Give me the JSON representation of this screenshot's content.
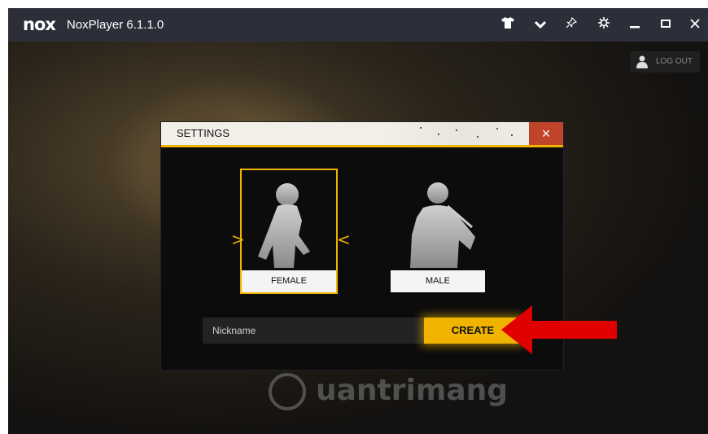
{
  "titlebar": {
    "logo": "nox",
    "title": "NoxPlayer 6.1.1.0",
    "icons": [
      "shirt-icon",
      "chevron-down-icon",
      "pin-icon",
      "gear-icon",
      "minimize-icon",
      "maximize-icon",
      "close-icon"
    ]
  },
  "game": {
    "logout_label": "LOG OUT"
  },
  "dialog": {
    "title": "SETTINGS",
    "close_symbol": "×",
    "characters": [
      {
        "label": "FEMALE",
        "selected": true
      },
      {
        "label": "MALE",
        "selected": false
      }
    ],
    "selector_left": ">",
    "selector_right": "<",
    "nickname_placeholder": "Nickname",
    "create_label": "CREATE"
  },
  "annotation": {
    "arrow_color": "#e00000"
  },
  "watermark": {
    "text": "uantrimang"
  },
  "colors": {
    "accent": "#f0b400",
    "titlebar": "#2c2f3a",
    "close": "#c0442a"
  }
}
